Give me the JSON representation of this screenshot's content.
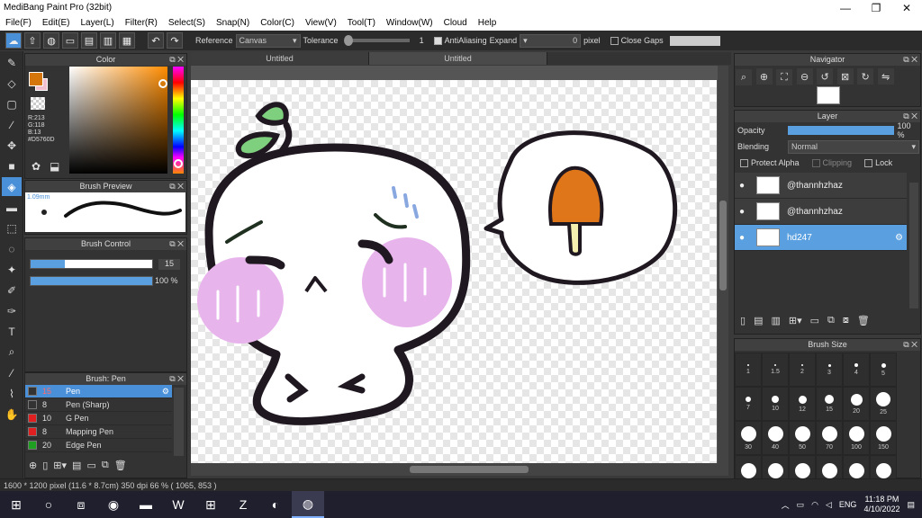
{
  "window": {
    "title": "MediBang Paint Pro (32bit)",
    "minimize": "—",
    "maximize": "❐",
    "close": "✕"
  },
  "menu": [
    "File(F)",
    "Edit(E)",
    "Layer(L)",
    "Filter(R)",
    "Select(S)",
    "Snap(N)",
    "Color(C)",
    "View(V)",
    "Tool(T)",
    "Window(W)",
    "Cloud",
    "Help"
  ],
  "toolbar": {
    "reference_label": "Reference",
    "reference_value": "Canvas",
    "tolerance_label": "Tolerance",
    "tolerance_value": "1",
    "antialiasing_label": "AntiAliasing",
    "expand_label": "Expand",
    "expand_value": "0",
    "expand_unit": "pixel",
    "close_gaps_label": "Close Gaps"
  },
  "color_panel": {
    "title": "Color",
    "primary_color": "#D5760D",
    "r": "R:213",
    "g": "G:118",
    "b": "B:13",
    "hex": "#D5760D"
  },
  "brush_preview": {
    "title": "Brush Preview",
    "size": "1.09mm"
  },
  "brush_control": {
    "title": "Brush Control",
    "size_value": "15",
    "size_fraction": 0.28,
    "opacity_value": "100 %",
    "opacity_fraction": 1.0
  },
  "brush_list": {
    "title": "Brush: Pen",
    "items": [
      {
        "size": "15",
        "name": "Pen",
        "color": "#333333",
        "selected": true
      },
      {
        "size": "8",
        "name": "Pen (Sharp)",
        "color": "#333333",
        "selected": false
      },
      {
        "size": "10",
        "name": "G Pen",
        "color": "#e02020",
        "selected": false
      },
      {
        "size": "8",
        "name": "Mapping Pen",
        "color": "#e02020",
        "selected": false
      },
      {
        "size": "20",
        "name": "Edge Pen",
        "color": "#20a020",
        "selected": false
      }
    ]
  },
  "tabs": [
    "Untitled",
    "Untitled"
  ],
  "navigator": {
    "title": "Navigator"
  },
  "layer_panel": {
    "title": "Layer",
    "opacity_label": "Opacity",
    "opacity_value": "100 %",
    "blending_label": "Blending",
    "blending_value": "Normal",
    "protect_alpha": "Protect Alpha",
    "clipping": "Clipping",
    "lock": "Lock",
    "layers": [
      {
        "name": "@thannhzhaz",
        "selected": false
      },
      {
        "name": "@thannhzhaz",
        "selected": false
      },
      {
        "name": "hd247",
        "selected": true
      }
    ]
  },
  "brush_size_panel": {
    "title": "Brush Size",
    "sizes": [
      "1",
      "1.5",
      "2",
      "3",
      "4",
      "5",
      "7",
      "10",
      "12",
      "15",
      "20",
      "25",
      "30",
      "40",
      "50",
      "70",
      "100",
      "150",
      "",
      "",
      "",
      "",
      "",
      ""
    ]
  },
  "status": {
    "text": "1600 * 1200 pixel   (11.6 * 8.7cm)   350 dpi   66 %   ( 1065, 853 )"
  },
  "taskbar": {
    "lang": "ENG",
    "time": "11:18 PM",
    "date": "4/10/2022"
  }
}
